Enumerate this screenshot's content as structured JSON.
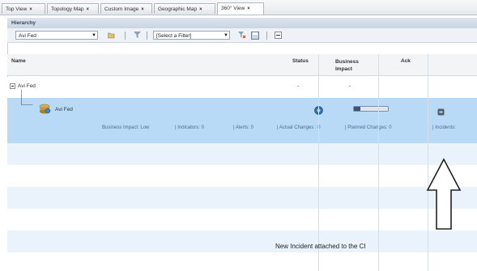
{
  "tabs": [
    {
      "label": "Top View",
      "active": false
    },
    {
      "label": "Topology Map",
      "active": false
    },
    {
      "label": "Custom Image",
      "active": false
    },
    {
      "label": "Geographic Map",
      "active": false
    },
    {
      "label": "360° View",
      "active": true
    }
  ],
  "tab_close_glyph": "×",
  "panel_title": "Hierarchy",
  "toolbar": {
    "view_select_value": "Avi Fed",
    "filter_select_value": "[Select a Filter]"
  },
  "columns": {
    "name": "Name",
    "status": "Status",
    "business_impact": "Business Impact",
    "ack": "Ack"
  },
  "rows": [
    {
      "name": "Avi Fed",
      "status": "-",
      "business_impact": "-"
    },
    {
      "name": "Avi Fed",
      "status_icon": "status-icon",
      "impact_bar_fill": 0.2,
      "ack_icon": "ack-icon"
    }
  ],
  "details": {
    "business_impact": "Business Impact: Low",
    "indicators": "| Indicators: 0",
    "alerts": "| Alerts: 0",
    "actual_changes": "| Actual Changes : 0",
    "planned_changes": "| Planned Changes: 0",
    "incidents": "| Incidents:"
  },
  "annotation": "New Incident attached to the CI",
  "colors": {
    "selected_row": "#b8daf6",
    "stripe": "#eaf2fb",
    "header": "#f2f4f6"
  }
}
